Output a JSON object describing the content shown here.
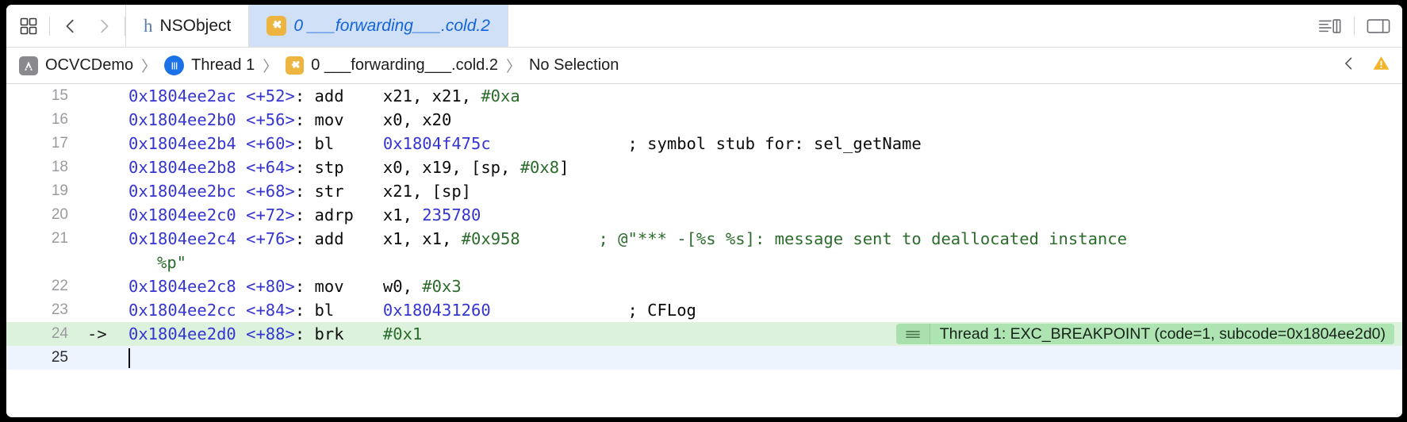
{
  "window": {
    "title": "Xcode Disassembly View"
  },
  "tabbar": {
    "grid_icon": "grid-icon",
    "back_icon": "chevron-left-icon",
    "forward_icon": "chevron-right-icon",
    "tabs": [
      {
        "label": "NSObject",
        "icon": "header-file-icon",
        "active": false
      },
      {
        "label": "0 ___forwarding___.cold.2",
        "icon": "puzzle-icon",
        "active": true
      }
    ],
    "right_icons": [
      {
        "name": "editor-options-icon"
      },
      {
        "name": "inspector-toggle-icon"
      }
    ]
  },
  "breadcrumb": {
    "items": [
      {
        "label": "OCVCDemo",
        "icon": "app-icon"
      },
      {
        "label": "Thread 1",
        "icon": "thread-icon"
      },
      {
        "label": "0 ___forwarding___.cold.2",
        "icon": "puzzle-icon"
      },
      {
        "label": "No Selection",
        "icon": null
      }
    ],
    "separator": "〉",
    "right": {
      "prev_issue_icon": "chevron-left-icon",
      "warning_icon": "warning-triangle-icon"
    }
  },
  "editor": {
    "accent_color": "#1463d8",
    "pc_highlight_color": "#ddf2dd",
    "cursor_highlight_color": "#eef4fd",
    "issue_badge_color": "#aee3b2",
    "lines": [
      {
        "number": "15",
        "arrow": "",
        "address": "0x1804ee2ac",
        "offset": "<+52>",
        "mnemonic": "add",
        "operands_pre": "x21, x21, ",
        "immediate": "#0xa",
        "operands_post": "",
        "reference": "",
        "comment": "",
        "comment_green": false
      },
      {
        "number": "16",
        "arrow": "",
        "address": "0x1804ee2b0",
        "offset": "<+56>",
        "mnemonic": "mov",
        "operands_pre": "x0, x20",
        "immediate": "",
        "operands_post": "",
        "reference": "",
        "comment": "",
        "comment_green": false
      },
      {
        "number": "17",
        "arrow": "",
        "address": "0x1804ee2b4",
        "offset": "<+60>",
        "mnemonic": "bl",
        "operands_pre": "",
        "immediate": "",
        "operands_post": "",
        "reference": "0x1804f475c",
        "comment": "; symbol stub for: sel_getName",
        "comment_green": false
      },
      {
        "number": "18",
        "arrow": "",
        "address": "0x1804ee2b8",
        "offset": "<+64>",
        "mnemonic": "stp",
        "operands_pre": "x0, x19, [sp, ",
        "immediate": "#0x8",
        "operands_post": "]",
        "reference": "",
        "comment": "",
        "comment_green": false
      },
      {
        "number": "19",
        "arrow": "",
        "address": "0x1804ee2bc",
        "offset": "<+68>",
        "mnemonic": "str",
        "operands_pre": "x21, [sp]",
        "immediate": "",
        "operands_post": "",
        "reference": "",
        "comment": "",
        "comment_green": false
      },
      {
        "number": "20",
        "arrow": "",
        "address": "0x1804ee2c0",
        "offset": "<+72>",
        "mnemonic": "adrp",
        "operands_pre": "x1, ",
        "immediate": "",
        "operands_post": "",
        "reference": "235780",
        "comment": "",
        "comment_green": false
      },
      {
        "number": "21",
        "arrow": "",
        "address": "0x1804ee2c4",
        "offset": "<+76>",
        "mnemonic": "add",
        "operands_pre": "x1, x1, ",
        "immediate": "#0x958",
        "operands_post": "",
        "reference": "",
        "comment": "; @\"*** -[%s %s]: message sent to deallocated instance",
        "comment_wrap": "%p\"",
        "comment_green": true
      },
      {
        "number": "22",
        "arrow": "",
        "address": "0x1804ee2c8",
        "offset": "<+80>",
        "mnemonic": "mov",
        "operands_pre": "w0, ",
        "immediate": "#0x3",
        "operands_post": "",
        "reference": "",
        "comment": "",
        "comment_green": false
      },
      {
        "number": "23",
        "arrow": "",
        "address": "0x1804ee2cc",
        "offset": "<+84>",
        "mnemonic": "bl",
        "operands_pre": "",
        "immediate": "",
        "operands_post": "",
        "reference": "0x180431260",
        "comment": "; CFLog",
        "comment_green": false
      },
      {
        "number": "24",
        "arrow": "->",
        "address": "0x1804ee2d0",
        "offset": "<+88>",
        "mnemonic": "brk",
        "operands_pre": "",
        "immediate": "#0x1",
        "operands_post": "",
        "reference": "",
        "comment": "",
        "comment_green": false,
        "is_pc": true,
        "issue": "Thread 1: EXC_BREAKPOINT (code=1, subcode=0x1804ee2d0)"
      },
      {
        "number": "25",
        "arrow": "",
        "address": "",
        "offset": "",
        "mnemonic": "",
        "operands_pre": "",
        "immediate": "",
        "operands_post": "",
        "reference": "",
        "comment": "",
        "comment_green": false,
        "is_cursor": true
      }
    ]
  }
}
